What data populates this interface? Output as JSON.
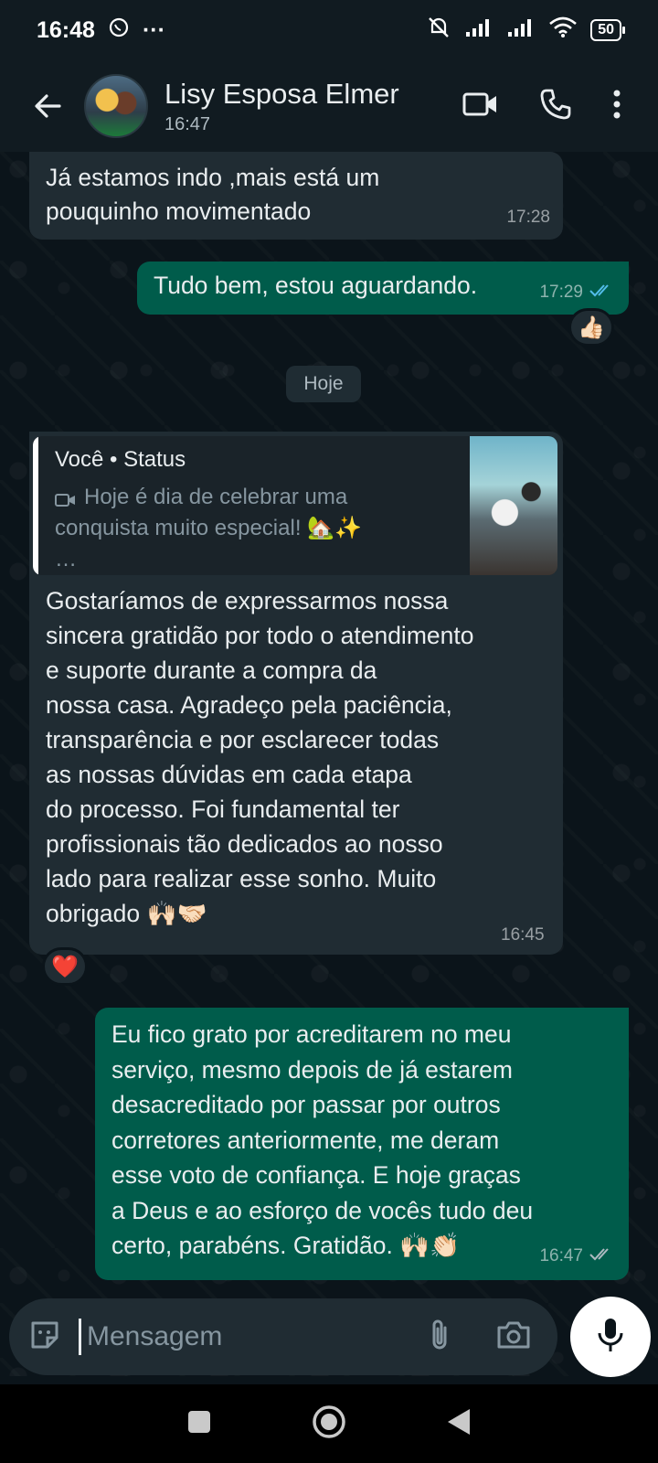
{
  "status_bar": {
    "time": "16:48",
    "more": "···",
    "battery": "50"
  },
  "header": {
    "contact_name": "Lisy Esposa Elmer",
    "last_seen": "16:47"
  },
  "messages": [
    {
      "direction": "in",
      "text": "Já estamos indo ,mais está um\npouquinho movimentado",
      "time": "17:28"
    },
    {
      "direction": "out",
      "text": "Tudo bem, estou aguardando.",
      "time": "17:29",
      "read": true,
      "reaction": "👍🏻"
    },
    {
      "direction": "in",
      "reply_to": {
        "title": "Você • Status",
        "preview": "Hoje é dia de celebrar uma\nconquista muito especial! 🏡✨\n…"
      },
      "text": "Gostaríamos de expressarmos nossa\nsincera gratidão por todo o atendimento\ne suporte durante a compra da\nnossa casa. Agradeço pela paciência,\ntransparência e por esclarecer todas\nas nossas dúvidas em cada etapa\ndo processo. Foi fundamental ter\nprofissionais tão dedicados ao nosso\nlado para realizar esse sonho. Muito\nobrigado 🙌🏻🤝🏻",
      "time": "16:45",
      "reaction": "❤️"
    },
    {
      "direction": "out",
      "text": "Eu fico grato por acreditarem no meu\nserviço, mesmo depois de já estarem\ndesacreditado por passar por outros\ncorretores anteriormente, me deram\nesse voto de confiança. E hoje graças\na Deus e ao esforço de vocês tudo deu\ncerto, parabéns. Gratidão. 🙌🏻👏🏻",
      "time": "16:47",
      "read": false
    }
  ],
  "date_separator": "Hoje",
  "composer": {
    "placeholder": "Mensagem"
  },
  "colors": {
    "background": "#0b141a",
    "incoming_bubble": "#202c33",
    "outgoing_bubble": "#005c4b",
    "read_ticks": "#53bdeb",
    "header": "#111b21"
  },
  "icons": [
    "back-arrow-icon",
    "video-call-icon",
    "phone-icon",
    "more-vert-icon",
    "sticker-icon",
    "attach-icon",
    "camera-icon",
    "mic-icon",
    "recents-icon",
    "home-icon",
    "back-icon"
  ]
}
